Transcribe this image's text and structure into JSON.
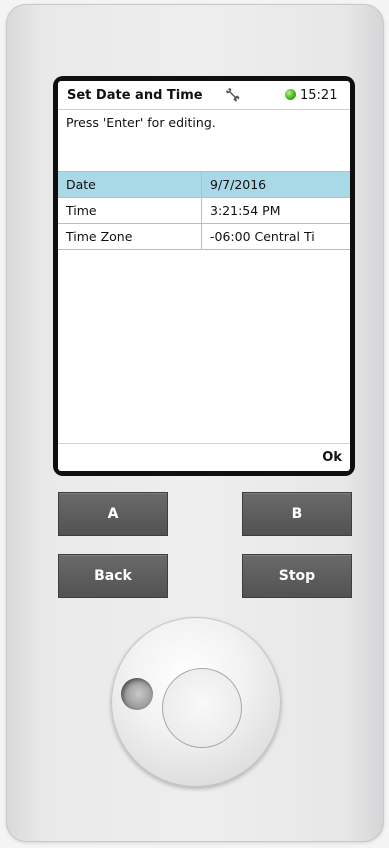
{
  "screen": {
    "title": "Set Date and Time",
    "time": "15:21",
    "status_color": "#43b51a",
    "hint": "Press 'Enter' for editing.",
    "rows": [
      {
        "label": "Date",
        "value": "9/7/2016",
        "selected": true
      },
      {
        "label": "Time",
        "value": "3:21:54 PM",
        "selected": false
      },
      {
        "label": "Time Zone",
        "value": "-06:00 Central Ti",
        "selected": false
      }
    ],
    "ok_label": "Ok",
    "selection_color": "#a9d8e6"
  },
  "buttons": {
    "a_label": "A",
    "b_label": "B",
    "back_label": "Back",
    "stop_label": "Stop"
  },
  "icons": {
    "tool": "wrench-icon",
    "status": "status-led-icon"
  }
}
